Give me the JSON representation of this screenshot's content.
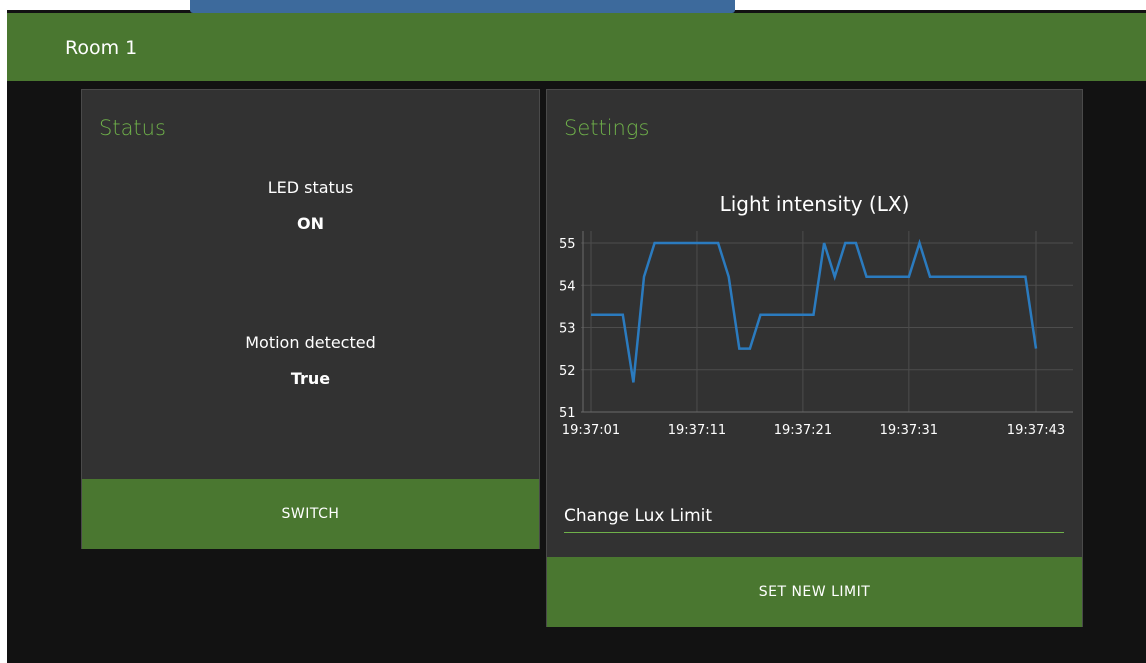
{
  "header": {
    "title": "Room 1"
  },
  "status_card": {
    "title": "Status",
    "led_label": "LED status",
    "led_value": "ON",
    "motion_label": "Motion detected",
    "motion_value": "True",
    "switch_label": "SWITCH"
  },
  "settings_card": {
    "title": "Settings",
    "lux_placeholder": "Change Lux Limit",
    "set_label": "SET NEW LIMIT"
  },
  "colors": {
    "accent_green": "#4a7730",
    "title_green": "#6fb14a",
    "line_blue": "#2b7bbf",
    "background": "#121212",
    "card": "#323232"
  },
  "chart_data": {
    "type": "line",
    "title": "Light intensity (LX)",
    "xlabel": "",
    "ylabel": "",
    "ylim": [
      51,
      55
    ],
    "grid": true,
    "x_tick_labels": [
      "19:37:01",
      "19:37:11",
      "19:37:21",
      "19:37:31",
      "19:37:43"
    ],
    "y_tick_labels": [
      "55",
      "54",
      "53",
      "52",
      "51"
    ],
    "series": [
      {
        "x": [
          "19:37:01",
          "19:37:02",
          "19:37:03",
          "19:37:04",
          "19:37:05",
          "19:37:06",
          "19:37:07",
          "19:37:08",
          "19:37:09",
          "19:37:10",
          "19:37:11",
          "19:37:12",
          "19:37:13",
          "19:37:14",
          "19:37:15",
          "19:37:16",
          "19:37:17",
          "19:37:18",
          "19:37:19",
          "19:37:20",
          "19:37:21",
          "19:37:22",
          "19:37:23",
          "19:37:24",
          "19:37:25",
          "19:37:26",
          "19:37:27",
          "19:37:28",
          "19:37:29",
          "19:37:30",
          "19:37:31",
          "19:37:32",
          "19:37:33",
          "19:37:34",
          "19:37:35",
          "19:37:36",
          "19:37:37",
          "19:37:38",
          "19:37:39",
          "19:37:40",
          "19:37:41",
          "19:37:42",
          "19:37:43"
        ],
        "values": [
          53.3,
          53.3,
          53.3,
          53.3,
          51.7,
          54.2,
          55,
          55,
          55,
          55,
          55,
          55,
          55,
          54.2,
          52.5,
          52.5,
          53.3,
          53.3,
          53.3,
          53.3,
          53.3,
          53.3,
          55,
          54.2,
          55,
          55,
          54.2,
          54.2,
          54.2,
          54.2,
          54.2,
          55,
          54.2,
          54.2,
          54.2,
          54.2,
          54.2,
          54.2,
          54.2,
          54.2,
          54.2,
          54.2,
          52.5
        ]
      }
    ]
  }
}
